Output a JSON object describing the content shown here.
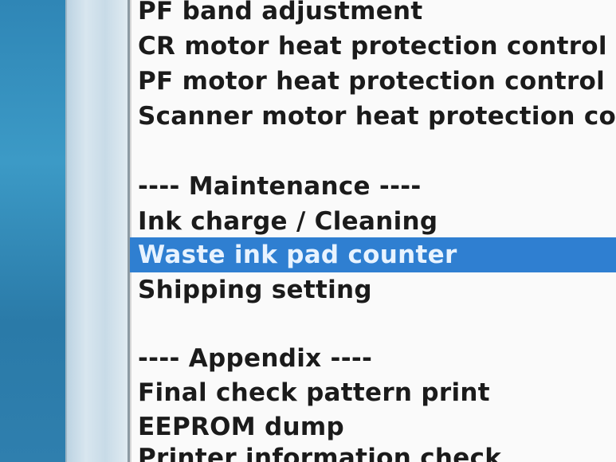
{
  "list": {
    "items": [
      {
        "label": "PF band adjustment",
        "selected": false
      },
      {
        "label": "CR motor heat protection control",
        "selected": false
      },
      {
        "label": "PF motor heat protection control",
        "selected": false
      },
      {
        "label": "Scanner motor heat protection co",
        "selected": false
      },
      {
        "label": "",
        "selected": false
      },
      {
        "label": "---- Maintenance ----",
        "selected": false
      },
      {
        "label": "Ink charge / Cleaning",
        "selected": false
      },
      {
        "label": "Waste ink pad counter",
        "selected": true
      },
      {
        "label": "Shipping setting",
        "selected": false
      },
      {
        "label": "",
        "selected": false
      },
      {
        "label": "---- Appendix ----",
        "selected": false
      },
      {
        "label": "Final check pattern print",
        "selected": false
      },
      {
        "label": "EEPROM dump",
        "selected": false
      },
      {
        "label": "Printer information check",
        "selected": false
      }
    ]
  },
  "colors": {
    "selection": "#2f7fd1",
    "list_background": "#fafafa",
    "text": "#1b1b1b"
  }
}
